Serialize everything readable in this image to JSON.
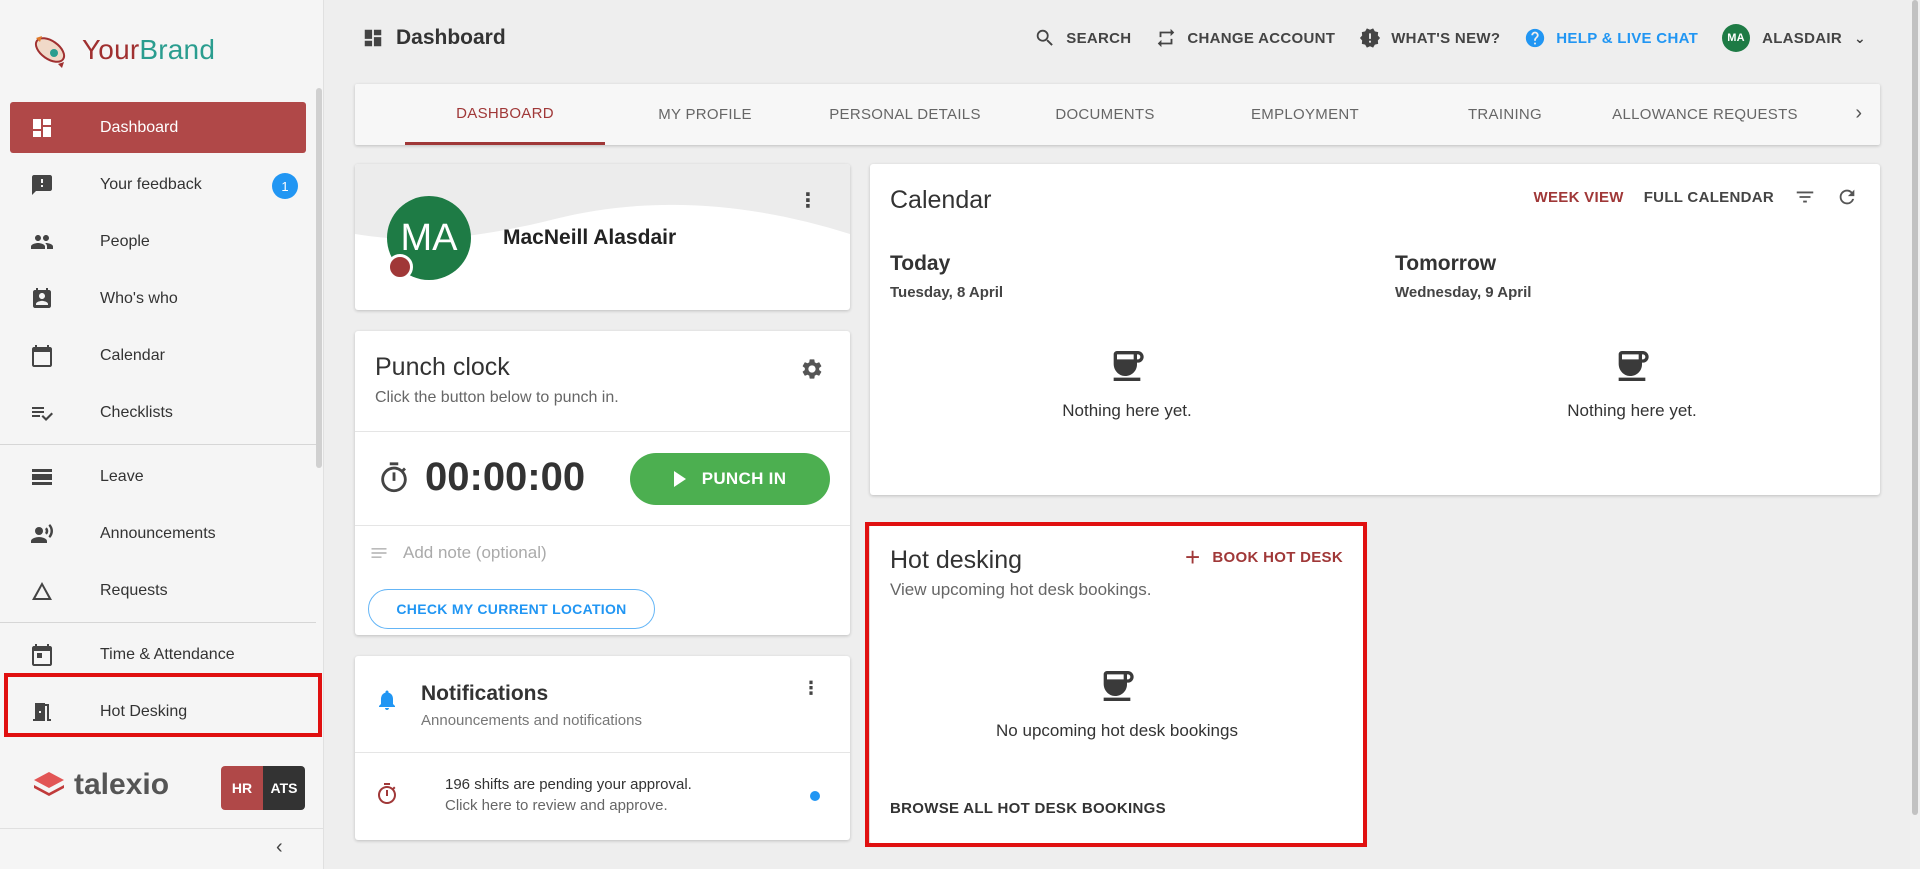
{
  "brand": {
    "part1": "Your",
    "part2": "Brand"
  },
  "sidebar": {
    "items": [
      {
        "label": "Dashboard",
        "icon": "dashboard-icon",
        "active": true
      },
      {
        "label": "Your feedback",
        "icon": "feedback-icon",
        "badge": "1"
      },
      {
        "label": "People",
        "icon": "people-icon"
      },
      {
        "label": "Who's who",
        "icon": "contact-badge-icon"
      },
      {
        "label": "Calendar",
        "icon": "calendar-icon"
      },
      {
        "label": "Checklists",
        "icon": "checklist-icon"
      },
      {
        "label": "Leave",
        "icon": "leave-icon"
      },
      {
        "label": "Announcements",
        "icon": "megaphone-person-icon"
      },
      {
        "label": "Requests",
        "icon": "triangle-icon"
      },
      {
        "label": "Time & Attendance",
        "icon": "calendar-today-icon"
      },
      {
        "label": "Hot Desking",
        "icon": "door-icon"
      }
    ],
    "footer": {
      "product": "talexio",
      "hr": "HR",
      "ats": "ATS"
    }
  },
  "header": {
    "title": "Dashboard",
    "search": "SEARCH",
    "change_account": "CHANGE ACCOUNT",
    "whats_new": "WHAT'S NEW?",
    "help": "HELP & LIVE CHAT",
    "user_initials": "MA",
    "user_name": "ALASDAIR"
  },
  "tabs": [
    "DASHBOARD",
    "MY PROFILE",
    "PERSONAL DETAILS",
    "DOCUMENTS",
    "EMPLOYMENT",
    "TRAINING",
    "ALLOWANCE REQUESTS"
  ],
  "profile": {
    "initials": "MA",
    "name": "MacNeill Alasdair"
  },
  "punch_clock": {
    "title": "Punch clock",
    "subtitle": "Click the button below to punch in.",
    "time": "00:00:00",
    "button": "PUNCH IN",
    "note_placeholder": "Add note (optional)",
    "location_button": "CHECK MY CURRENT LOCATION"
  },
  "notifications": {
    "title": "Notifications",
    "subtitle": "Announcements and notifications",
    "item_line1": "196 shifts are pending your approval.",
    "item_line2": "Click here to review and approve."
  },
  "calendar": {
    "title": "Calendar",
    "week_view": "WEEK VIEW",
    "full_calendar": "FULL CALENDAR",
    "today_label": "Today",
    "today_date": "Tuesday, 8 April",
    "tomorrow_label": "Tomorrow",
    "tomorrow_date": "Wednesday, 9 April",
    "empty_text": "Nothing here yet."
  },
  "hot_desking": {
    "title": "Hot desking",
    "subtitle": "View upcoming hot desk bookings.",
    "book_button": "BOOK HOT DESK",
    "empty_text": "No upcoming hot desk bookings",
    "browse_link": "BROWSE ALL HOT DESK BOOKINGS"
  },
  "colors": {
    "accent": "#a03838",
    "primary_blue": "#2196f3",
    "success": "#4caf50",
    "avatar": "#1e7b45",
    "highlight": "#e01010"
  }
}
